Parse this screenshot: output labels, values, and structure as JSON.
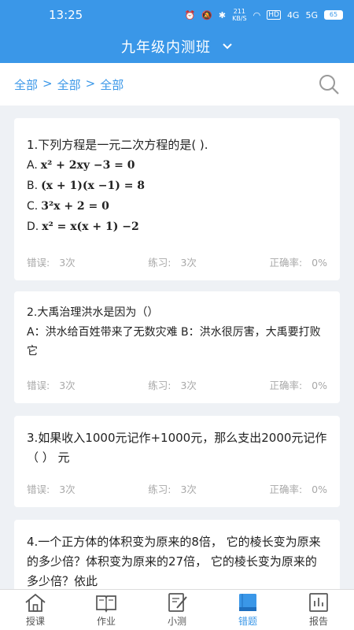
{
  "status": {
    "time": "13:25",
    "network_speed": "211",
    "network_unit": "KB/S",
    "hd": "HD",
    "signal1": "4G",
    "signal2": "5G",
    "battery": "65"
  },
  "header": {
    "title": "九年级内测班"
  },
  "breadcrumb": {
    "items": [
      "全部",
      "全部",
      "全部"
    ],
    "separator": ">"
  },
  "questions": [
    {
      "title": "1.下列方程是一元二次方程的是( ).",
      "options": [
        {
          "letter": "A.",
          "math": "x² + 2xy −3 = 0"
        },
        {
          "letter": "B.",
          "math": "(x + 1)(x −1) = 8"
        },
        {
          "letter": "C.",
          "math": "3²x + 2 = 0"
        },
        {
          "letter": "D.",
          "math": "x² = x(x + 1) −2"
        }
      ],
      "error_label": "错误:",
      "error_value": "3次",
      "practice_label": "练习:",
      "practice_value": "3次",
      "accuracy_label": "正确率:",
      "accuracy_value": "0%"
    },
    {
      "title": "2.大禹治理洪水是因为（）",
      "body": "A：洪水给百姓带来了无数灾难   B：洪水很厉害，大禹要打败它",
      "error_label": "错误:",
      "error_value": "3次",
      "practice_label": "练习:",
      "practice_value": "3次",
      "accuracy_label": "正确率:",
      "accuracy_value": "0%"
    },
    {
      "title": "3.如果收入1000元记作+1000元，那么支出2000元记作 （ ） 元",
      "error_label": "错误:",
      "error_value": "3次",
      "practice_label": "练习:",
      "practice_value": "3次",
      "accuracy_label": "正确率:",
      "accuracy_value": "0%"
    },
    {
      "title": "4.一个正方体的体积变为原来的8倍， 它的棱长变为原来的多少倍？体积变为原来的27倍， 它的棱长变为原来的多少倍？依此"
    }
  ],
  "nav": {
    "items": [
      {
        "label": "授课",
        "icon": "home-icon"
      },
      {
        "label": "作业",
        "icon": "book-icon"
      },
      {
        "label": "小测",
        "icon": "edit-icon"
      },
      {
        "label": "错题",
        "icon": "notebook-icon",
        "active": true
      },
      {
        "label": "报告",
        "icon": "chart-icon"
      }
    ]
  },
  "colors": {
    "primary": "#3a97e8",
    "muted": "#a8a8a8",
    "background": "#eef1f5"
  }
}
